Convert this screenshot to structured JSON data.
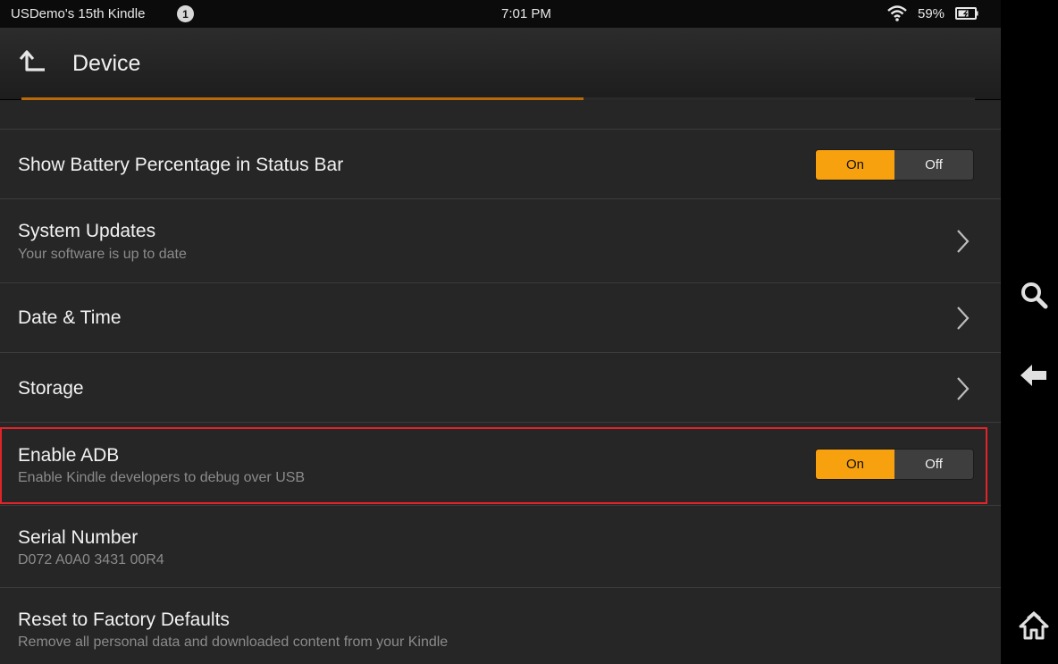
{
  "status_bar": {
    "device_name": "USDemo's 15th Kindle",
    "notification_count": "1",
    "time": "7:01 PM",
    "battery_percent": "59%"
  },
  "header": {
    "title": "Device"
  },
  "settings": [
    {
      "title": "Show Battery Percentage in Status Bar",
      "toggle": {
        "on": "On",
        "off": "Off",
        "state": "on"
      }
    },
    {
      "title": "System Updates",
      "subtitle": "Your software is up to date"
    },
    {
      "title": "Date & Time"
    },
    {
      "title": "Storage"
    },
    {
      "title": "Enable ADB",
      "subtitle": "Enable Kindle developers to debug over USB",
      "toggle": {
        "on": "On",
        "off": "Off",
        "state": "on"
      }
    },
    {
      "title": "Serial Number",
      "subtitle": "D072 A0A0 3431 00R4"
    },
    {
      "title": "Reset to Factory Defaults",
      "subtitle": "Remove all personal data and downloaded content from your Kindle"
    }
  ],
  "colors": {
    "accent": "#f8a10f",
    "highlight_border": "#e2232a",
    "background": "#262626"
  },
  "side_nav": [
    "search-icon",
    "back-arrow-icon",
    "home-icon"
  ]
}
